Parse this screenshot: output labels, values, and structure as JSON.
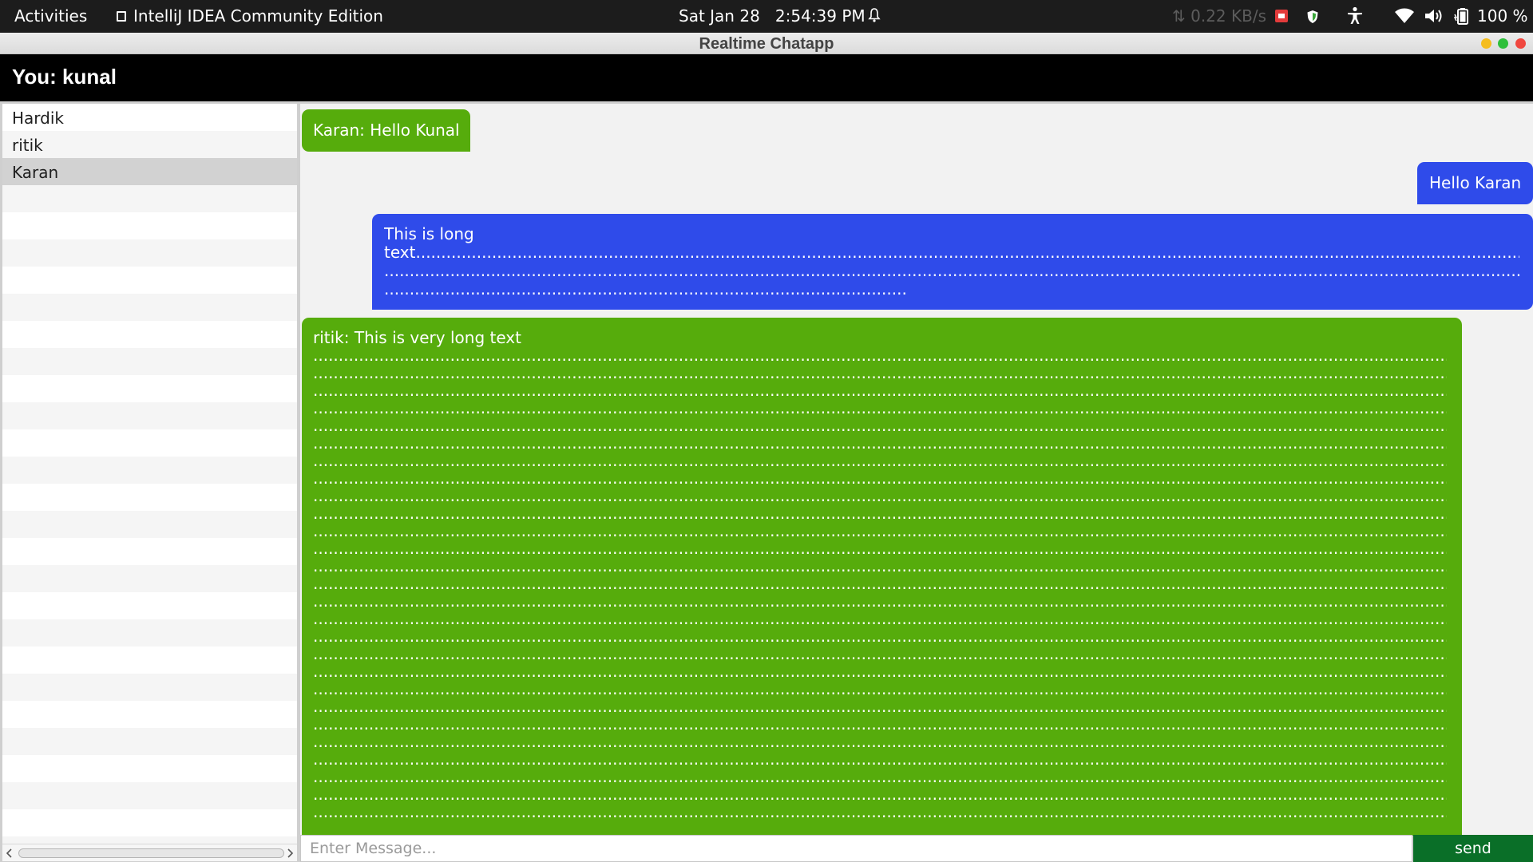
{
  "topbar": {
    "activities": "Activities",
    "app_name": "IntelliJ IDEA Community Edition",
    "date": "Sat Jan 28",
    "time": "2:54:39 PM",
    "net_speed": "⇅ 0.22 KB/s",
    "battery_pct": "100 %",
    "icons": [
      "app-window-icon",
      "alarm-bell-icon",
      "red-app-indicator-icon",
      "shield-icon",
      "accessibility-icon",
      "wifi-icon",
      "volume-icon",
      "battery-icon"
    ]
  },
  "window": {
    "title": "Realtime Chatapp"
  },
  "header": {
    "you_label": "You: kunal"
  },
  "contacts": {
    "items": [
      {
        "label": "Hardik"
      },
      {
        "label": "ritik"
      },
      {
        "label": "Karan",
        "selected": true
      }
    ]
  },
  "messages": [
    {
      "text": "Karan: Hello Kunal",
      "side": "left",
      "color": "#56ac0c"
    },
    {
      "text": "Hello Karan",
      "side": "right",
      "color": "#2f4bea"
    },
    {
      "text": "This is long\ntext.............................................................................................................................................................................................................................................................\n................................................................................................................................................................................................................................................................\n.......................................................................................................",
      "side": "right",
      "color": "#2f4bea"
    },
    {
      "text": "ritik: This is very long text\n........................................................................................................................................................................................................................................................\n........................................................................................................................................................................................................................................................\n........................................................................................................................................................................................................................................................\n........................................................................................................................................................................................................................................................\n........................................................................................................................................................................................................................................................\n........................................................................................................................................................................................................................................................\n........................................................................................................................................................................................................................................................\n........................................................................................................................................................................................................................................................\n........................................................................................................................................................................................................................................................\n........................................................................................................................................................................................................................................................\n........................................................................................................................................................................................................................................................\n........................................................................................................................................................................................................................................................\n........................................................................................................................................................................................................................................................\n........................................................................................................................................................................................................................................................\n........................................................................................................................................................................................................................................................\n........................................................................................................................................................................................................................................................\n........................................................................................................................................................................................................................................................\n........................................................................................................................................................................................................................................................\n........................................................................................................................................................................................................................................................\n........................................................................................................................................................................................................................................................\n........................................................................................................................................................................................................................................................\n........................................................................................................................................................................................................................................................\n........................................................................................................................................................................................................................................................\n........................................................................................................................................................................................................................................................\n........................................................................................................................................................................................................................................................\n........................................................................................................................................................................................................................................................\n........................................................................................................................................................................................................................................................",
      "side": "left",
      "color": "#56ac0c"
    }
  ],
  "input": {
    "placeholder": "Enter Message..."
  },
  "send_label": "send",
  "colors": {
    "header_bg": "#000000",
    "send_button": "#0a6f28",
    "incoming_bubble": "#56ac0c",
    "outgoing_bubble": "#2f4bea"
  }
}
